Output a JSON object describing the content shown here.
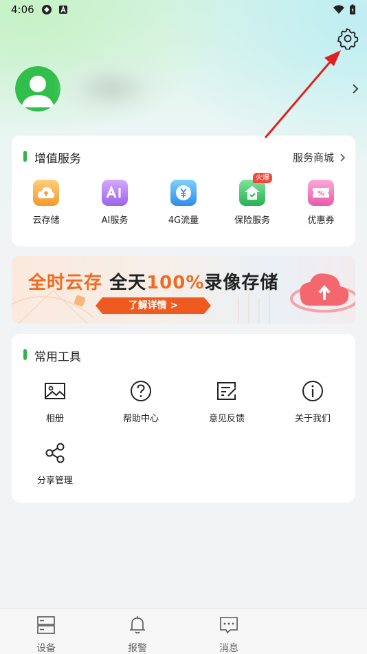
{
  "status_bar": {
    "time": "4:06"
  },
  "header": {
    "settings_icon": "gear-icon",
    "avatar_icon": "user-avatar-icon"
  },
  "value_services": {
    "title": "增值服务",
    "shop_link": "服务商城",
    "items": [
      {
        "label": "云存储",
        "icon": "cloud-upload-icon",
        "color": "#f7a640"
      },
      {
        "label": "AI服务",
        "icon": "ai-icon",
        "color": "#b07ef0"
      },
      {
        "label": "4G流量",
        "icon": "yen-coin-icon",
        "color": "#3ea2f2"
      },
      {
        "label": "保险服务",
        "icon": "shield-home-icon",
        "color": "#3cc26a",
        "badge": "火爆"
      },
      {
        "label": "优惠券",
        "icon": "coupon-icon",
        "color": "#ef6fb6"
      }
    ]
  },
  "banner": {
    "headline_part1": "全时云存",
    "headline_part2": "全天",
    "headline_part3": "100%",
    "headline_part4": "录像存储",
    "cta": "了解详情 >"
  },
  "tools": {
    "title": "常用工具",
    "items": [
      {
        "label": "相册",
        "icon": "image-icon"
      },
      {
        "label": "帮助中心",
        "icon": "help-circle-icon"
      },
      {
        "label": "意见反馈",
        "icon": "feedback-icon"
      },
      {
        "label": "关于我们",
        "icon": "info-circle-icon"
      },
      {
        "label": "分享管理",
        "icon": "share-icon"
      }
    ]
  },
  "bottom_nav": [
    {
      "label": "设备",
      "icon": "device-icon"
    },
    {
      "label": "报警",
      "icon": "bell-icon"
    },
    {
      "label": "消息",
      "icon": "message-icon"
    }
  ],
  "colors": {
    "accent_green": "#2fb54a",
    "cta_orange": "#ef5a20",
    "annotation_red": "#e02020"
  }
}
